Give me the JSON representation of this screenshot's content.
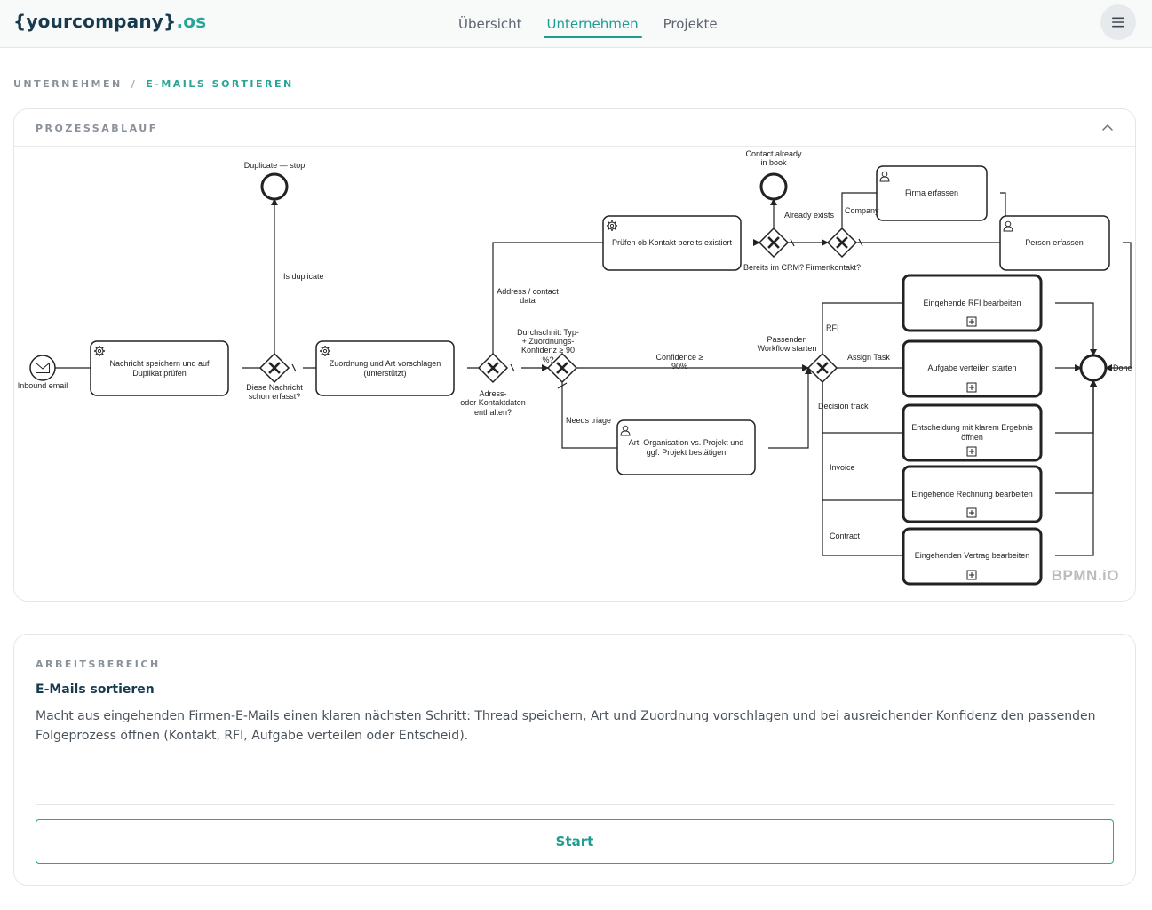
{
  "header": {
    "logo_main": "{yourcompany}",
    "logo_suffix": ".os",
    "tabs": [
      {
        "label": "Übersicht",
        "active": false
      },
      {
        "label": "Unternehmen",
        "active": true
      },
      {
        "label": "Projekte",
        "active": false
      }
    ],
    "menu_icon": "hamburger-icon"
  },
  "breadcrumb": {
    "root": "UNTERNEHMEN",
    "separator": "/",
    "current": "E-MAILS SORTIEREN"
  },
  "process": {
    "section_label": "PROZESSABLAUF",
    "collapse_icon": "chevron-up-icon",
    "watermark": "BPMN.iO",
    "diagram": {
      "start_event": "Inbound email",
      "end_duplicate": "Duplicate — stop",
      "end_contact": [
        "Contact already",
        "in book"
      ],
      "task_store": [
        "Nachricht speichern und auf",
        "Duplikat prüfen"
      ],
      "gw_duplicate": [
        "Diese Nachricht",
        "schon erfasst?"
      ],
      "flow_is_duplicate": "Is duplicate",
      "task_assign": [
        "Zuordnung und Art vorschlagen",
        "(unterstützt)"
      ],
      "gw_address": [
        "Adress-",
        "oder Kontaktdaten",
        "enthalten?"
      ],
      "flow_address": [
        "Address / contact",
        "data"
      ],
      "gw_confidence": [
        "Durchschnitt Typ-",
        "+ Zuordnungs-",
        "Konfidenz ≥ 90",
        "%?"
      ],
      "flow_confidence": [
        "Confidence ≥",
        "90%"
      ],
      "flow_needs_triage": "Needs triage",
      "task_confirm": [
        "Art, Organisation vs. Projekt und",
        "ggf. Projekt bestätigen"
      ],
      "task_check_contact": "Prüfen ob Kontakt bereits existiert",
      "gw_crm": "Bereits im CRM?",
      "flow_already_exists": "Already exists",
      "gw_company": "Firmenkontakt?",
      "flow_company": "Company",
      "task_firma": "Firma erfassen",
      "task_person": "Person erfassen",
      "gw_workflow": [
        "Passenden",
        "Workflow starten"
      ],
      "flow_rfi": "RFI",
      "flow_assign_task": "Assign Task",
      "flow_decision_track": "Decision track",
      "flow_invoice": "Invoice",
      "flow_contract": "Contract",
      "sub_rfi": "Eingehende RFI bearbeiten",
      "sub_task": "Aufgabe verteilen starten",
      "sub_decision": [
        "Entscheidung mit klarem Ergebnis",
        "öffnen"
      ],
      "sub_invoice": "Eingehende Rechnung bearbeiten",
      "sub_contract": "Eingehenden Vertrag bearbeiten",
      "end_done_label": "Done"
    }
  },
  "workspace": {
    "section_label": "ARBEITSBEREICH",
    "title": "E-Mails sortieren",
    "description": "Macht aus eingehenden Firmen-E-Mails einen klaren nächsten Schritt: Thread speichern, Art und Zuordnung vorschlagen und bei ausreichender Konfidenz den passenden Folgeprozess öffnen (Kontakt, RFI, Aufgabe verteilen oder Entscheid).",
    "start_label": "Start"
  }
}
